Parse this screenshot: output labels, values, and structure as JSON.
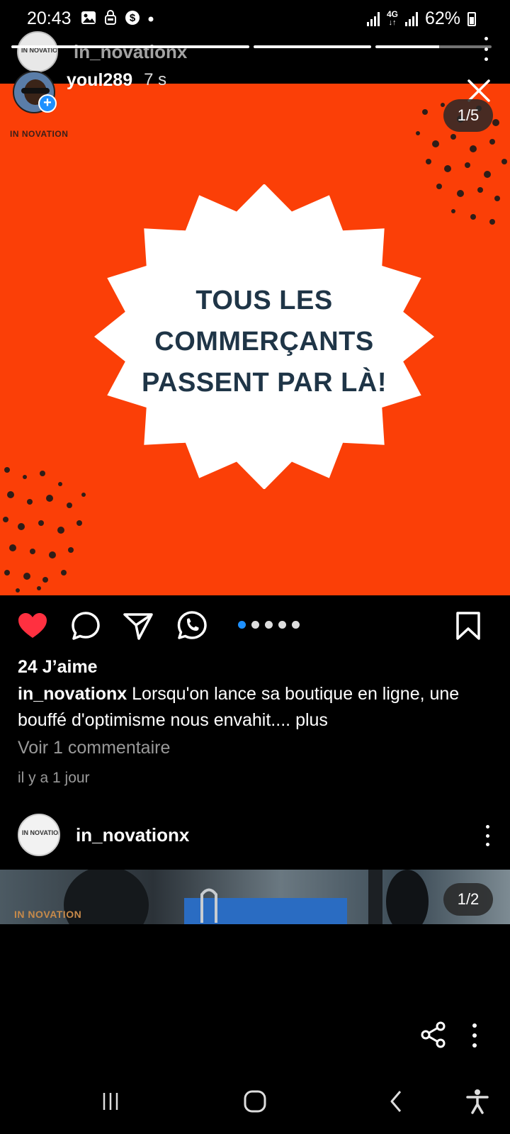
{
  "status_bar": {
    "time": "20:43",
    "network": "4G",
    "battery": "62%"
  },
  "story": {
    "segments_total": 3,
    "segment_current": 3,
    "account_top": "in_novationx",
    "username": "youl289",
    "time": "7 s"
  },
  "post": {
    "image_counter": "1/5",
    "brand_watermark": "IN NOVATION",
    "headline_line1": "TOUS LES",
    "headline_line2": "COMMERÇANTS",
    "headline_line3": "PASSENT PAR LÀ!",
    "accent_color": "#fb3f07",
    "carousel_dots": 5,
    "carousel_active": 1,
    "likes": "24 J’aime",
    "caption_user": "in_novationx",
    "caption_text": "Lorsqu'on lance sa boutique en ligne, une bouffé d'optimisme nous envahit....",
    "caption_more": "plus",
    "comments_link": "Voir 1 commentaire",
    "time_ago": "il y a 1 jour"
  },
  "next_post": {
    "username": "in_novationx",
    "avatar_text": "IN NOVATION",
    "image_counter": "1/2",
    "brand_watermark": "IN NOVATION"
  },
  "icons": {
    "like": "heart-icon",
    "comment": "comment-icon",
    "share": "paper-plane-icon",
    "whatsapp": "whatsapp-icon",
    "save": "bookmark-icon",
    "close": "close-icon",
    "more": "more-vertical-icon",
    "share_story": "share-nodes-icon"
  }
}
